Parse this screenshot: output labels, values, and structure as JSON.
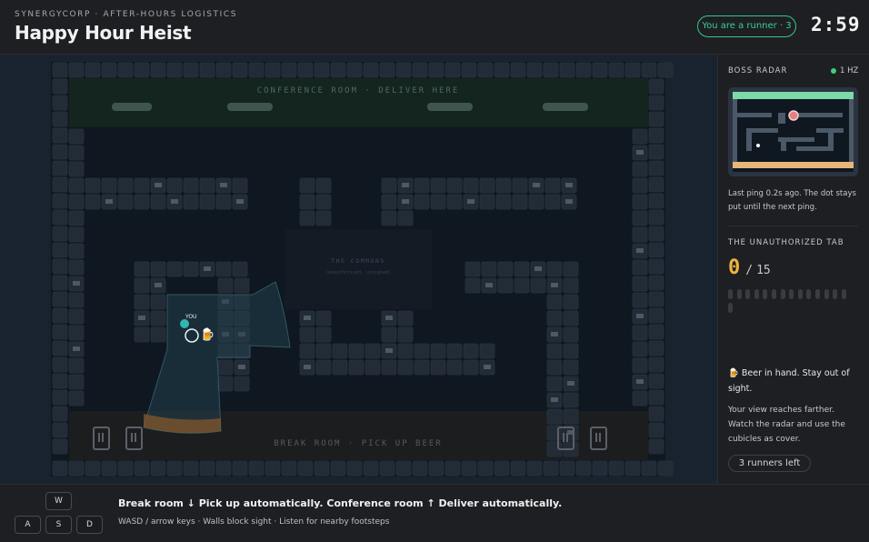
{
  "header": {
    "kicker": "SYNERGYCORP · AFTER-HOURS LOGISTICS",
    "title": "Happy Hour Heist",
    "role_badge": "You are a runner · 3",
    "timer": "2:59"
  },
  "map": {
    "conference_label": "CONFERENCE ROOM · DELIVER HERE",
    "commons_label": "THE COMMONS",
    "commons_sublabel": "(unauthorized, unsigned)",
    "breakroom_label": "BREAK ROOM · PICK UP BEER",
    "player_label": "YOU",
    "beer_icon": "🍺",
    "colors": {
      "floor": "#0f1720",
      "conference": "#14241f",
      "breakroom": "#1b1d1f",
      "wall": "#222b36",
      "player": "#2fb7b0",
      "vision": "#2a4a56"
    }
  },
  "sidebar": {
    "radar_title": "BOSS RADAR",
    "radar_freq": "1 HZ",
    "radar_note": "Last ping 0.2s ago. The dot stays put until the next ping.",
    "tab_title": "THE UNAUTHORIZED TAB",
    "tab_count": "0",
    "tab_separator": "/",
    "tab_total": "15",
    "tab_progress": 0,
    "status_icon": "🍺",
    "status_text": "Beer in hand. Stay out of sight.",
    "status_note": "Your view reaches farther. Watch the radar and use the cubicles as cover.",
    "runners_left": "3 runners left"
  },
  "footer": {
    "keys": [
      "W",
      "A",
      "S",
      "D"
    ],
    "help_main": "Break room ↓ Pick up automatically. Conference room ↑ Deliver automatically.",
    "help_sub": "WASD / arrow keys · Walls block sight · Listen for nearby footsteps"
  }
}
